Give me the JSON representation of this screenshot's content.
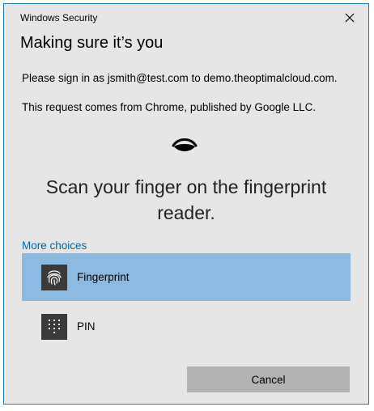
{
  "window": {
    "title": "Windows Security"
  },
  "dialog": {
    "heading": "Making sure it’s you",
    "signin_text": "Please sign in as jsmith@test.com to demo.theoptimalcloud.com.",
    "request_text": "This request comes from Chrome, published by Google LLC.",
    "scan_message": "Scan your finger on the fingerprint reader.",
    "more_choices_label": "More choices"
  },
  "options": [
    {
      "label": "Fingerprint",
      "icon": "fingerprint-icon",
      "selected": true
    },
    {
      "label": "PIN",
      "icon": "keypad-icon",
      "selected": false
    }
  ],
  "buttons": {
    "cancel_label": "Cancel"
  },
  "colors": {
    "accent": "#0066b4",
    "selected_bg": "#8bb9e0",
    "window_border": "#1979ca",
    "dialog_bg": "#e6e6e6",
    "button_bg": "#b3b3b3"
  }
}
